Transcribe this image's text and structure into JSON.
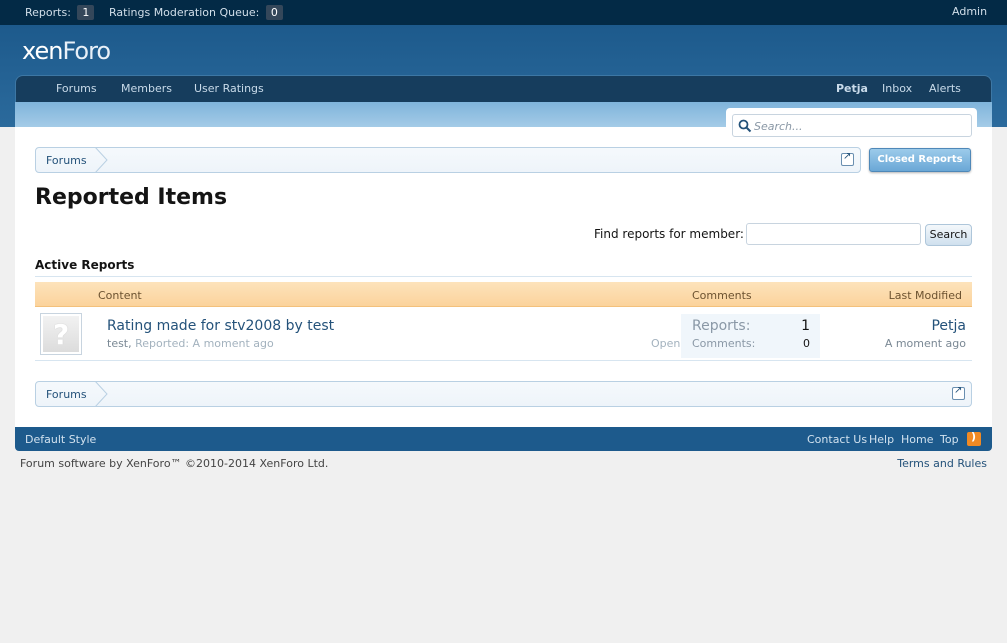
{
  "adminbar": {
    "reports_label": "Reports:",
    "reports_count": "1",
    "moderation_label": "Ratings Moderation Queue:",
    "moderation_count": "0",
    "admin_link": "Admin"
  },
  "header": {
    "logo_text_1": "xen",
    "logo_text_2": "Foro"
  },
  "nav": {
    "tabs": [
      "Forums",
      "Members",
      "User Ratings"
    ],
    "user": "Petja",
    "inbox": "Inbox",
    "alerts": "Alerts"
  },
  "search": {
    "placeholder": "Search..."
  },
  "breadcrumb": {
    "forums": "Forums"
  },
  "closed_reports_button": "Closed Reports",
  "page_title": "Reported Items",
  "find": {
    "label": "Find reports for member:",
    "button": "Search"
  },
  "section_title": "Active Reports",
  "table": {
    "headers": {
      "content": "Content",
      "comments": "Comments",
      "last_modified": "Last Modified"
    },
    "rows": [
      {
        "title": "Rating made for stv2008 by test",
        "user": "test",
        "reported": "Reported: A moment ago",
        "state": "Open",
        "reports_label": "Reports:",
        "reports_value": "1",
        "comments_label": "Comments:",
        "comments_value": "0",
        "modified_user": "Petja",
        "modified_time": "A moment ago"
      }
    ]
  },
  "footer": {
    "style": "Default Style",
    "contact": "Contact Us",
    "help": "Help",
    "home": "Home",
    "top": "Top",
    "copyright": "Forum software by XenForo™ ©2010-2014 XenForo Ltd.",
    "terms": "Terms and Rules"
  },
  "colors": {
    "admin_bar": "#032a46",
    "header": "#1d5a8c",
    "link": "#24527a",
    "table_header": "#fbd39c",
    "rss": "#f08a24"
  }
}
